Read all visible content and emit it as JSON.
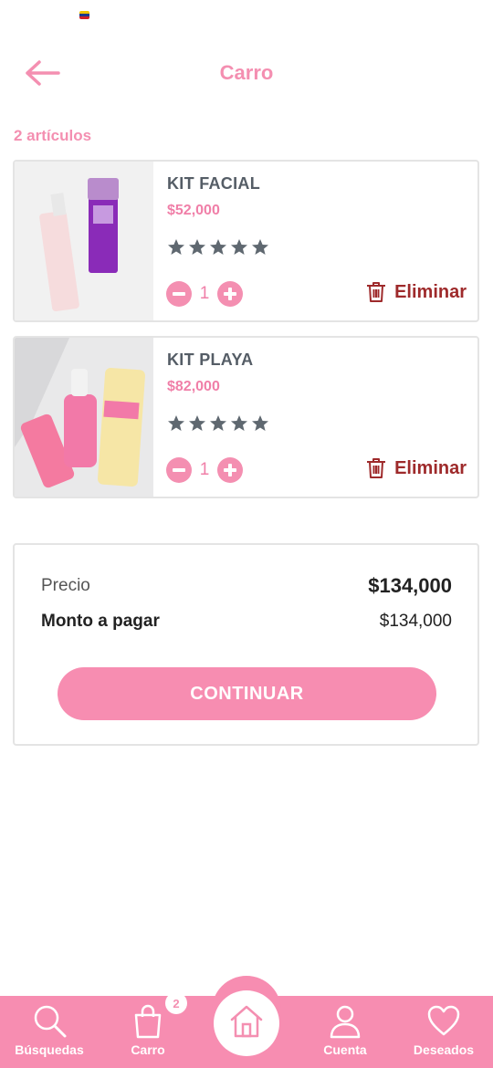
{
  "header": {
    "title": "Carro"
  },
  "cart": {
    "count_label": "2 artículos",
    "items": [
      {
        "name": "KIT FACIAL",
        "price": "$52,000",
        "quantity": "1",
        "rating": 5,
        "remove_label": "Eliminar"
      },
      {
        "name": "KIT PLAYA",
        "price": "$82,000",
        "quantity": "1",
        "rating": 5,
        "remove_label": "Eliminar"
      }
    ]
  },
  "summary": {
    "price_label": "Precio",
    "price_value": "$134,000",
    "total_label": "Monto a pagar",
    "total_value": "$134,000",
    "continue_label": "CONTINUAR"
  },
  "nav": {
    "search_label": "Búsquedas",
    "cart_label": "Carro",
    "cart_badge": "2",
    "account_label": "Cuenta",
    "wishlist_label": "Deseados"
  },
  "colors": {
    "accent": "#f48fb1",
    "nav_background": "#f78db1",
    "remove": "#9e2a2b",
    "star": "#5f6870"
  }
}
